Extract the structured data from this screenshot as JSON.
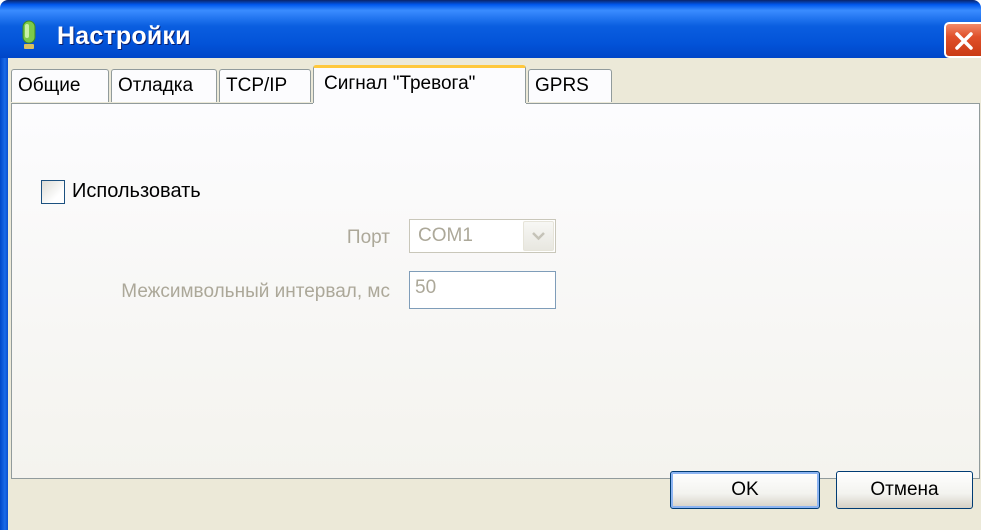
{
  "window": {
    "title": "Настройки",
    "close_glyph": "✕",
    "colors": {
      "title_bar": "#0058ee",
      "client_bg": "#ece9d8",
      "close_button": "#e0502a",
      "active_tab_accent": "#ffc83c"
    }
  },
  "tabs": [
    {
      "label": "Общие",
      "active": false
    },
    {
      "label": "Отладка",
      "active": false
    },
    {
      "label": "TCP/IP",
      "active": false
    },
    {
      "label": "Сигнал \"Тревога\"",
      "active": true
    },
    {
      "label": "GPRS",
      "active": false
    }
  ],
  "panel": {
    "use_checkbox": {
      "label": "Использовать",
      "checked": false
    },
    "port": {
      "label": "Порт",
      "value": "COM1",
      "enabled": false
    },
    "interval": {
      "label": "Межсимвольный интервал, мс",
      "value": "50",
      "enabled": false
    }
  },
  "buttons": {
    "ok": "OK",
    "cancel": "Отмена"
  },
  "icons": {
    "app": "app-icon",
    "close": "close-icon",
    "dropdown": "chevron-down-icon"
  }
}
